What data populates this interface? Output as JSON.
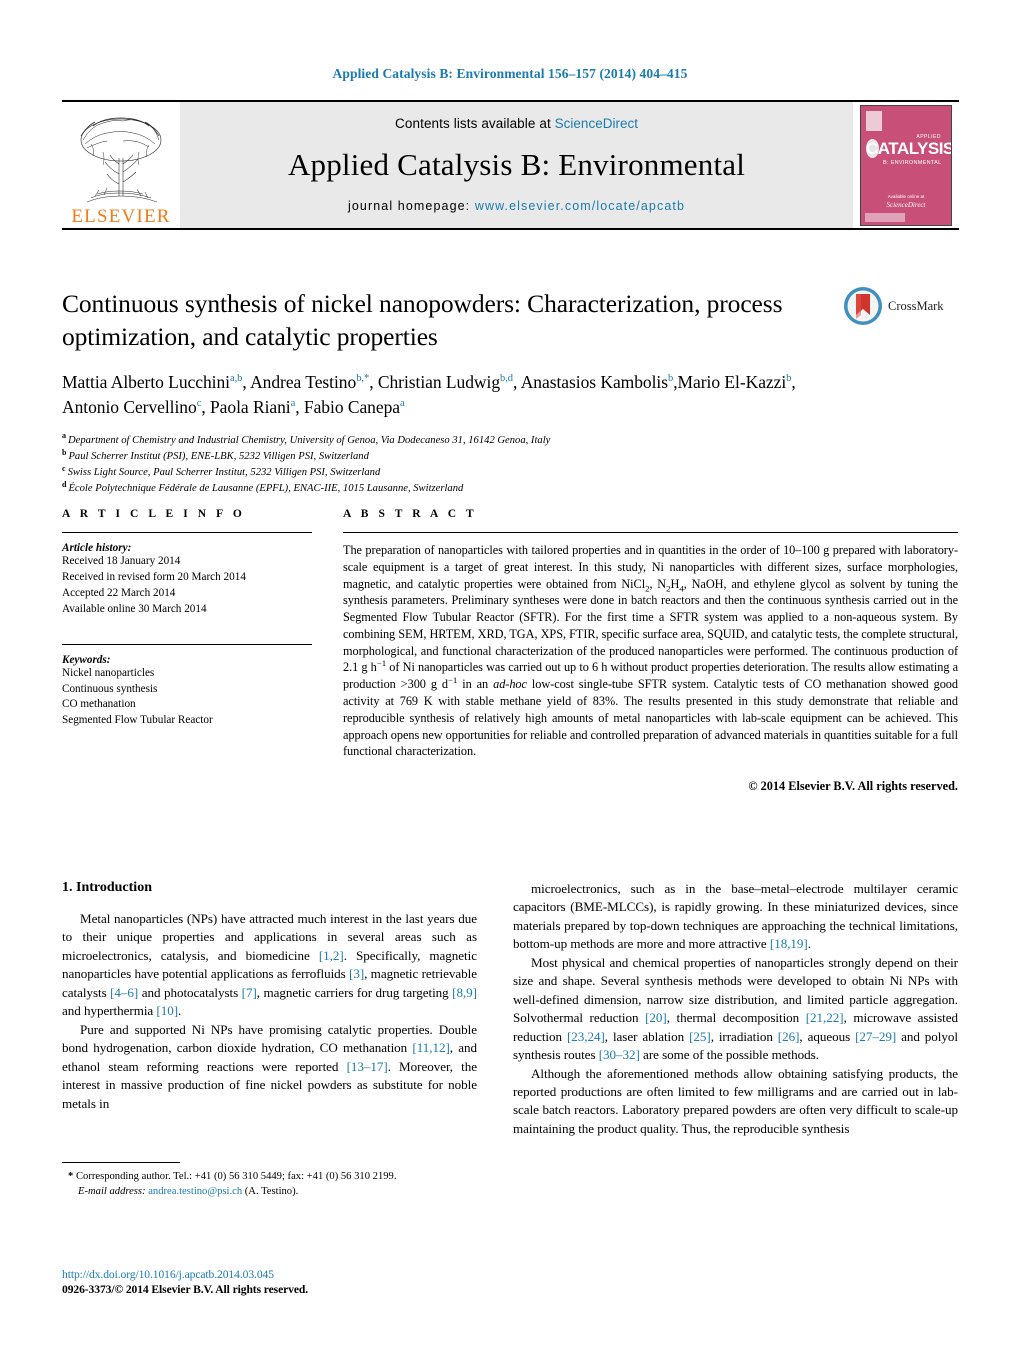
{
  "running_head": "Applied Catalysis B: Environmental 156–157 (2014) 404–415",
  "masthead": {
    "publisher": "ELSEVIER",
    "contents_prefix": "Contents lists available at ",
    "contents_link": "ScienceDirect",
    "journal_title": "Applied Catalysis B: Environmental",
    "homepage_label": "journal homepage:",
    "homepage_url": "www.elsevier.com/locate/apcatb",
    "cover": {
      "applied_label": "APPLIED",
      "main_label": "CATALYSIS",
      "sub_label": "B: ENVIRONMENTAL",
      "available_label": "Available online at",
      "sciencedirect_label": "ScienceDirect",
      "accent_color": "#c84f78"
    }
  },
  "article": {
    "title": "Continuous synthesis of nickel nanopowders: Characterization, process optimization, and catalytic properties",
    "authors": [
      {
        "name": "Mattia Alberto Lucchini",
        "sup": "a,b",
        "sep": ", "
      },
      {
        "name": "Andrea Testino",
        "sup": "b,*",
        "sep": ", "
      },
      {
        "name": "Christian Ludwig",
        "sup": "b,d",
        "sep": ", "
      },
      {
        "name": "Anastasios Kambolis",
        "sup": "b",
        "sep": ","
      },
      {
        "name": "Mario El-Kazzi",
        "sup": "b",
        "sep": ", "
      },
      {
        "name": "Antonio Cervellino",
        "sup": "c",
        "sep": ", "
      },
      {
        "name": "Paola Riani",
        "sup": "a",
        "sep": ", "
      },
      {
        "name": "Fabio Canepa",
        "sup": "a",
        "sep": ""
      }
    ],
    "affiliations": [
      {
        "marker": "a",
        "text": "Department of Chemistry and Industrial Chemistry, University of Genoa, Via Dodecaneso 31, 16142 Genoa, Italy"
      },
      {
        "marker": "b",
        "text": "Paul Scherrer Institut (PSI), ENE-LBK, 5232 Villigen PSI, Switzerland"
      },
      {
        "marker": "c",
        "text": "Swiss Light Source, Paul Scherrer Institut, 5232 Villigen PSI, Switzerland"
      },
      {
        "marker": "d",
        "text": "École Polytechnique Fédérale de Lausanne (EPFL), ENAC-IIE, 1015 Lausanne, Switzerland"
      }
    ]
  },
  "crossmark": {
    "label": "CrossMark"
  },
  "article_info": {
    "heading": "A R T I C L E    I N F O",
    "history_label": "Article history:",
    "history": [
      "Received 18 January 2014",
      "Received in revised form 20 March 2014",
      "Accepted 22 March 2014",
      "Available online 30 March 2014"
    ],
    "keywords_label": "Keywords:",
    "keywords": [
      "Nickel nanoparticles",
      "Continuous synthesis",
      "CO methanation",
      "Segmented Flow Tubular Reactor"
    ]
  },
  "abstract": {
    "heading": "A B S T R A C T",
    "paragraphs": [
      "The preparation of nanoparticles with tailored properties and in quantities in the order of 10–100 g prepared with laboratory-scale equipment is a target of great interest. In this study, Ni nanoparticles with different sizes, surface morphologies, magnetic, and catalytic properties were obtained from NiCl2, N2H4, NaOH, and ethylene glycol as solvent by tuning the synthesis parameters. Preliminary syntheses were done in batch reactors and then the continuous synthesis carried out in the Segmented Flow Tubular Reactor (SFTR). For the first time a SFTR system was applied to a non-aqueous system. By combining SEM, HRTEM, XRD, TGA, XPS, FTIR, specific surface area, SQUID, and catalytic tests, the complete structural, morphological, and functional characterization of the produced nanoparticles were performed. The continuous production of 2.1 g h−1 of Ni nanoparticles was carried out up to 6 h without product properties deterioration. The results allow estimating a production >300 g d−1 in an ad-hoc low-cost single-tube SFTR system. Catalytic tests of CO methanation showed good activity at 769 K with stable methane yield of 83%. The results presented in this study demonstrate that reliable and reproducible synthesis of relatively high amounts of metal nanoparticles with lab-scale equipment can be achieved. This approach opens new opportunities for reliable and controlled preparation of advanced materials in quantities suitable for a full functional characterization."
    ],
    "copyright": "© 2014 Elsevier B.V. All rights reserved."
  },
  "introduction": {
    "heading": "1.  Introduction",
    "left_paragraphs": [
      "Metal nanoparticles (NPs) have attracted much interest in the last years due to their unique properties and applications in several areas such as microelectronics, catalysis, and biomedicine [1,2]. Specifically, magnetic nanoparticles have potential applications as ferrofluids [3], magnetic retrievable catalysts [4–6] and photocatalysts [7], magnetic carriers for drug targeting [8,9] and hyperthermia [10].",
      "Pure and supported Ni NPs have promising catalytic properties. Double bond hydrogenation, carbon dioxide hydration, CO methanation [11,12], and ethanol steam reforming reactions were reported [13–17]. Moreover, the interest in massive production of fine nickel powders as substitute for noble metals in"
    ],
    "right_paragraphs": [
      "microelectronics, such as in the base–metal–electrode multilayer ceramic capacitors (BME-MLCCs), is rapidly growing. In these miniaturized devices, since materials prepared by top-down techniques are approaching the technical limitations, bottom-up methods are more and more attractive [18,19].",
      "Most physical and chemical properties of nanoparticles strongly depend on their size and shape. Several synthesis methods were developed to obtain Ni NPs with well-defined dimension, narrow size distribution, and limited particle aggregation. Solvothermal reduction [20], thermal decomposition [21,22], microwave assisted reduction [23,24], laser ablation [25], irradiation [26], aqueous [27–29] and polyol synthesis routes [30–32] are some of the possible methods.",
      "Although the aforementioned methods allow obtaining satisfying products, the reported productions are often limited to few milligrams and are carried out in lab-scale batch reactors. Laboratory prepared powders are often very difficult to scale-up maintaining the product quality. Thus, the reproducible synthesis"
    ]
  },
  "footnote": {
    "star": "*",
    "corresponding": "Corresponding author. Tel.: +41 (0) 56 310 5449; fax: +41 (0) 56 310 2199.",
    "email_label": "E-mail address:",
    "email": "andrea.testino@psi.ch",
    "email_suffix": "(A. Testino)."
  },
  "footer": {
    "doi": "http://dx.doi.org/10.1016/j.apcatb.2014.03.045",
    "issn": "0926-3373/© 2014 Elsevier B.V. All rights reserved."
  },
  "colors": {
    "link_blue": "#1a7bb0",
    "elsevier_orange": "#ef7c16",
    "masthead_grey": "#e9e9e9"
  }
}
